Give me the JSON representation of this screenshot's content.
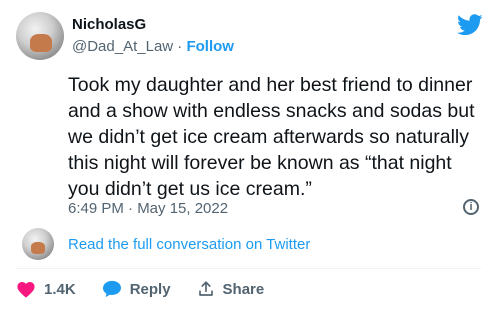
{
  "author": {
    "name": "NicholasG",
    "handle": "@Dad_At_Law",
    "separator": "·",
    "follow_label": "Follow"
  },
  "tweet": {
    "text": "Took my daughter and her best friend to dinner and a show with endless snacks and sodas but we didn’t get ice cream afterwards so naturally this night will forever be known as “that night you didn’t get us ice cream.”",
    "timestamp": "6:49 PM · May 15, 2022",
    "read_full": "Read the full conversation on Twitter"
  },
  "actions": {
    "like_count": "1.4K",
    "reply_label": "Reply",
    "share_label": "Share"
  },
  "icons": {
    "brand": "twitter-bird-icon",
    "like": "heart-icon",
    "reply": "speech-bubble-icon",
    "share": "share-upload-icon",
    "info": "info-icon"
  },
  "colors": {
    "accent": "#1d9bf0",
    "like": "#f91880",
    "muted": "#536471",
    "text": "#0f1419"
  }
}
